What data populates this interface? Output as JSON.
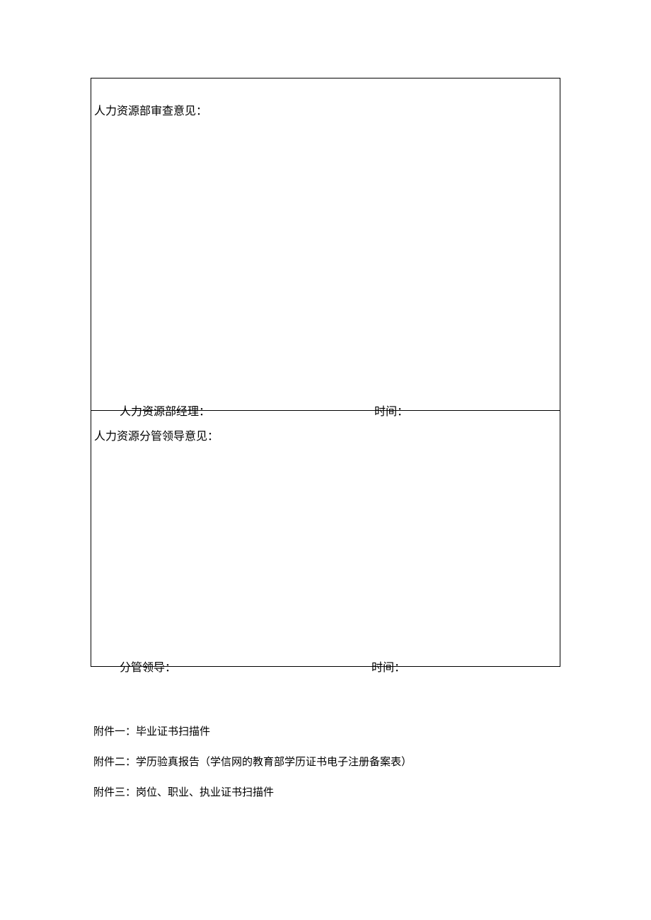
{
  "form": {
    "section1": {
      "title": "人力资源部审查意见：",
      "signer_label": "人力资源部经理：",
      "time_label": "时间："
    },
    "section2": {
      "title": "人力资源分管领导意见：",
      "signer_label": "分管领导：",
      "time_label": "时间："
    }
  },
  "attachments": [
    "附件一：毕业证书扫描件",
    "附件二：学历验真报告（学信网的教育部学历证书电子注册备案表）",
    "附件三：岗位、职业、执业证书扫描件"
  ]
}
